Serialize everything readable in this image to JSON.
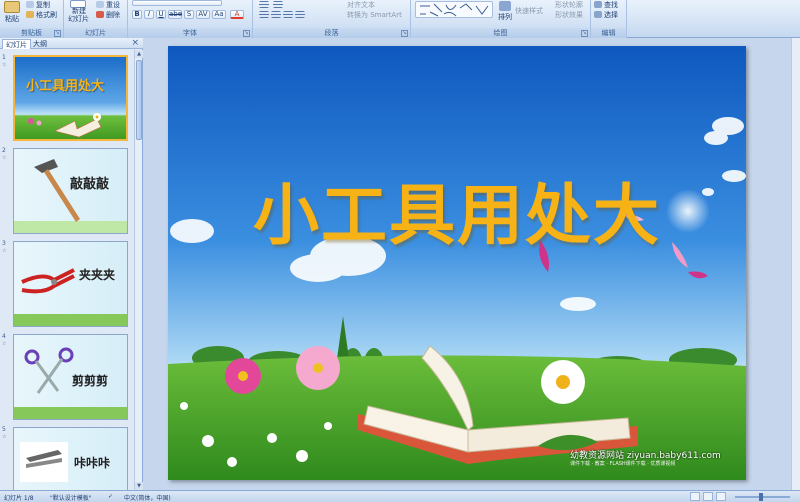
{
  "ribbon": {
    "clipboard": {
      "paste": "粘贴",
      "copy": "复制",
      "format_painter": "格式刷",
      "label": "剪贴板"
    },
    "slides": {
      "new_slide": "新建",
      "new_slide_line2": "幻灯片",
      "reset": "重设",
      "delete": "删除",
      "label": "幻灯片"
    },
    "font": {
      "bold": "B",
      "italic": "I",
      "underline": "U",
      "strike": "abe",
      "shadow": "S",
      "spacing": "AV",
      "case": "Aa",
      "color": "A",
      "label": "字体"
    },
    "paragraph": {
      "convert_smartart": "转换为 SmartArt",
      "text_align": "对齐文本",
      "label": "段落"
    },
    "drawing": {
      "arrange": "排列",
      "quick_styles": "快速样式",
      "shape_outline": "形状轮廓",
      "shape_effects": "形状效果",
      "label": "绘图"
    },
    "editing": {
      "find": "查找",
      "select": "选择",
      "label": "编辑"
    }
  },
  "left_panel": {
    "tab_slides": "幻灯片",
    "tab_outline": "大纲",
    "close": "×",
    "thumbnails": [
      {
        "num": "1",
        "title": "小工具用处大",
        "selected": true
      },
      {
        "num": "2",
        "title": "敲敲敲",
        "selected": false
      },
      {
        "num": "3",
        "title": "夹夹夹",
        "selected": false
      },
      {
        "num": "4",
        "title": "剪剪剪",
        "selected": false
      },
      {
        "num": "5",
        "title": "咔咔咔",
        "selected": false
      }
    ]
  },
  "slide": {
    "title": "小工具用处大",
    "watermark": "幼教资源网站  ziyuan.baby611.com",
    "watermark_sub": "课件下载 · 教案 · FLASH课件下载 · 优质课视频"
  },
  "status": {
    "slide_count": "幻灯片 1/8",
    "theme": "\"默认设计模板\"",
    "language": "中文(简体，中国)"
  },
  "colors": {
    "title": "#f7b215",
    "sky_top": "#1668c8",
    "grass": "#5caa2d",
    "selection": "#f4b73b"
  }
}
